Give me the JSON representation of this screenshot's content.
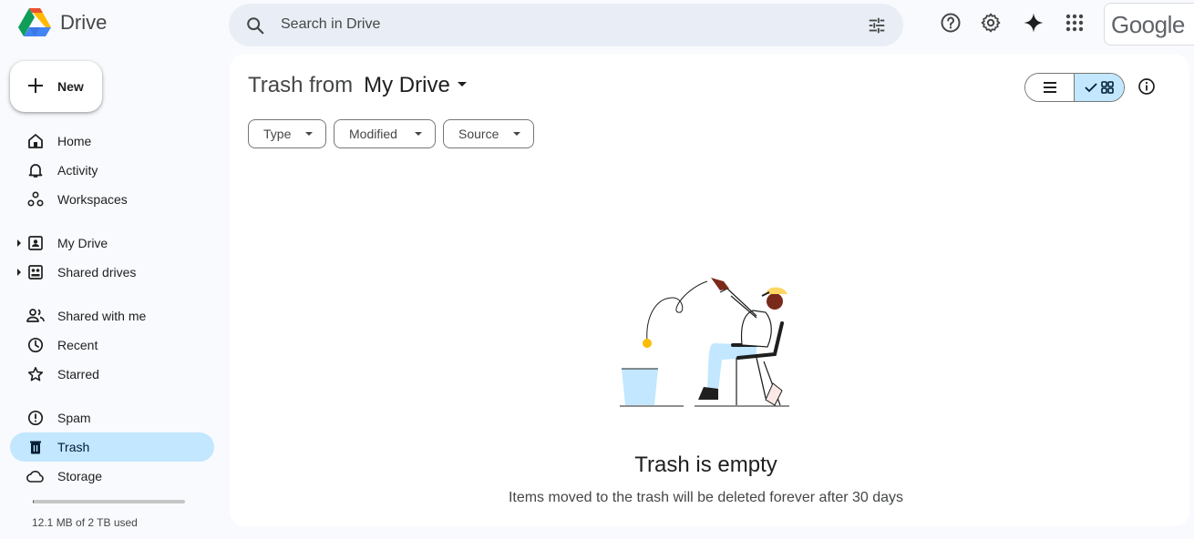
{
  "app": {
    "name": "Drive"
  },
  "search": {
    "placeholder": "Search in Drive"
  },
  "header": {
    "google_label": "Google"
  },
  "new_button": {
    "label": "New"
  },
  "sidebar": {
    "items": [
      {
        "label": "Home",
        "icon": "home-icon"
      },
      {
        "label": "Activity",
        "icon": "bell-icon"
      },
      {
        "label": "Workspaces",
        "icon": "workspaces-icon"
      },
      {
        "label": "My Drive",
        "icon": "my-drive-icon"
      },
      {
        "label": "Shared drives",
        "icon": "shared-drives-icon"
      },
      {
        "label": "Shared with me",
        "icon": "people-icon"
      },
      {
        "label": "Recent",
        "icon": "clock-icon"
      },
      {
        "label": "Starred",
        "icon": "star-icon"
      },
      {
        "label": "Spam",
        "icon": "spam-icon"
      },
      {
        "label": "Trash",
        "icon": "trash-icon",
        "active": true
      },
      {
        "label": "Storage",
        "icon": "cloud-icon"
      }
    ],
    "storage_text": "12.1 MB of 2 TB used",
    "storage_fraction": 0.006
  },
  "main": {
    "title_prefix": "Trash from",
    "title_location": "My Drive",
    "filters": [
      "Type",
      "Modified",
      "Source"
    ],
    "empty_title": "Trash is empty",
    "empty_subtitle": "Items moved to the trash will be deleted forever after 30 days"
  },
  "colors": {
    "active_nav": "#c2e7ff",
    "background": "#f8fafd",
    "accent": "#0b57d0"
  }
}
